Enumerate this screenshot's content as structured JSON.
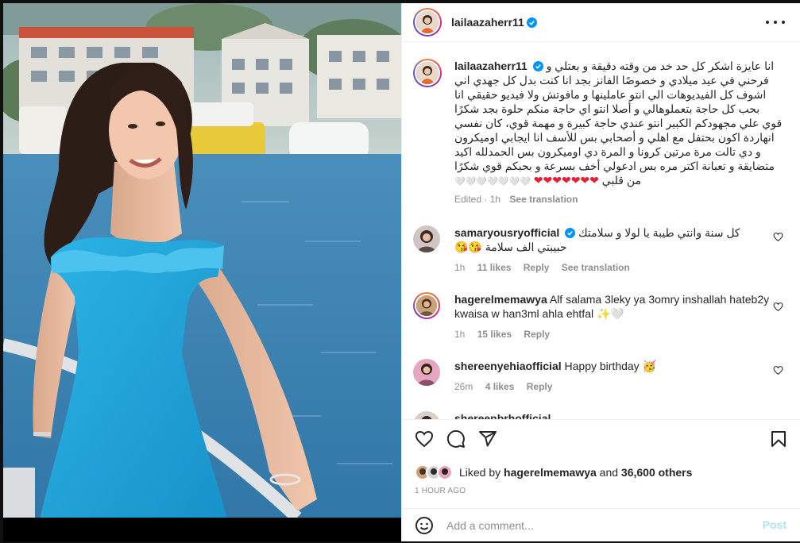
{
  "post": {
    "author": "lailaazaherr11",
    "verified": true,
    "caption_lines": [
      "انا عايزة اشكر كل حد خد من وقته دقيقة و بعتلي و",
      "فرحني في عيد ميلادي و خصوصًا الفانز بجد انا كنت بدل كل جهدي اني",
      "اشوف كل الفيديوهات الي انتو عاملينها و مافوتش ولا فيديو حقيقي انا",
      "بحب كل حاجة بتعملوهالي و أصلا انتو اي حاجة منكم حلوة بجد شكرًا",
      "قوي علي مجهودكم الكبير انتو عندي حاجة كبيرة و مهمة قوي، كان نفسي",
      "انهاردة اكون بحتفل مع اهلي و أصحابي بس للأسف انا ايجابي اوميكرون",
      "و دي تالت مرة مرتين كرونا و المرة دي اوميكرون بس الحمدلله اكيد",
      "متضايقة و تعبانة اكتر مره بس ادعولي أخف بسرعة و بحبكم قوي شكرًا",
      "من قلبي"
    ],
    "caption_hearts": "❤❤❤❤❤❤❤",
    "caption_tail": "🤍🤍🤍🤍🤍🤍🤍",
    "edited_label": "Edited",
    "edited_time": "1h",
    "see_translation": "See translation"
  },
  "comments": [
    {
      "user": "samaryousryofficial",
      "verified": true,
      "text_line1": "كل سنة وانتي طيبة يا لولا و سلامتك",
      "text_line2": "حبيبتي الف سلامة 😘😘",
      "time": "1h",
      "likes": "11 likes",
      "reply": "Reply",
      "translate": "See translation"
    },
    {
      "user": "hagerelmemawya",
      "verified": false,
      "text": "Alf salama 3leky ya 3omry inshallah hateb2y kwaisa w han3ml ahla ehtfal ✨🤍",
      "time": "1h",
      "likes": "15 likes",
      "reply": "Reply"
    },
    {
      "user": "shereenyehiaofficial",
      "verified": false,
      "text": "Happy birthday 🥳",
      "time": "26m",
      "likes": "4 likes",
      "reply": "Reply"
    }
  ],
  "partial_comment": "shereenbrhofficial",
  "actions": {
    "liked_by_prefix": "Liked by",
    "liked_by_user": "hagerelmemawya",
    "and": "and",
    "others": "36,600 others",
    "time_ago": "1 HOUR AGO"
  },
  "add_comment": {
    "placeholder": "Add a comment...",
    "post_label": "Post"
  },
  "colors": {
    "link_blue": "#0095f6",
    "verified_blue": "#0095f6",
    "post_disabled": "#b2dffc",
    "muted": "#8e8e8e",
    "dress": "#1ea6dc",
    "water": "#3b87b7"
  },
  "icons": [
    "more-icon",
    "heart-icon",
    "comment-icon",
    "share-icon",
    "save-icon",
    "emoji-icon",
    "verified-icon"
  ]
}
